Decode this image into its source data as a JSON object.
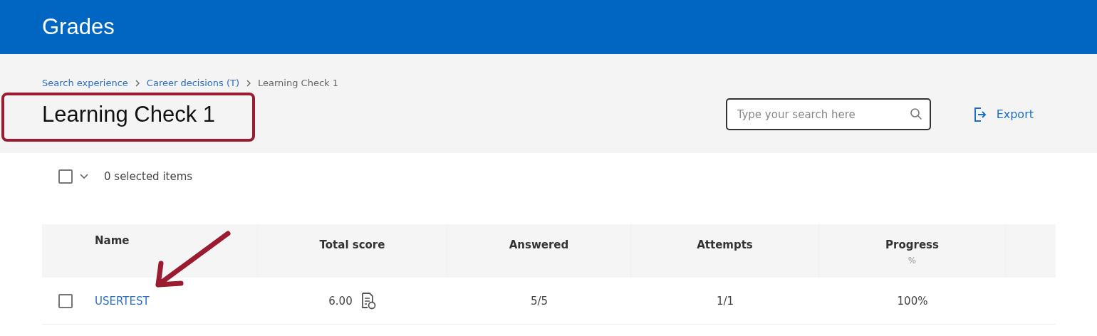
{
  "app_bar": {
    "title": "Grades"
  },
  "breadcrumb": [
    {
      "label": "Search experience",
      "kind": "link"
    },
    {
      "label": "Career decisions (T)",
      "kind": "link"
    },
    {
      "label": "Learning Check 1",
      "kind": "current"
    }
  ],
  "page_title": "Learning Check 1",
  "search": {
    "placeholder": "Type your search here"
  },
  "export_button": "Export",
  "selection": {
    "checked": false,
    "label": "0 selected items"
  },
  "table": {
    "columns": [
      {
        "label": "Name"
      },
      {
        "label": "Total score"
      },
      {
        "label": "Answered"
      },
      {
        "label": "Attempts"
      },
      {
        "label": "Progress",
        "unit": "%"
      }
    ],
    "rows": [
      {
        "checked": false,
        "name": "USERTEST",
        "total_score": "6.00",
        "answered": "5/5",
        "attempts": "1/1",
        "progress": "100%"
      }
    ]
  }
}
